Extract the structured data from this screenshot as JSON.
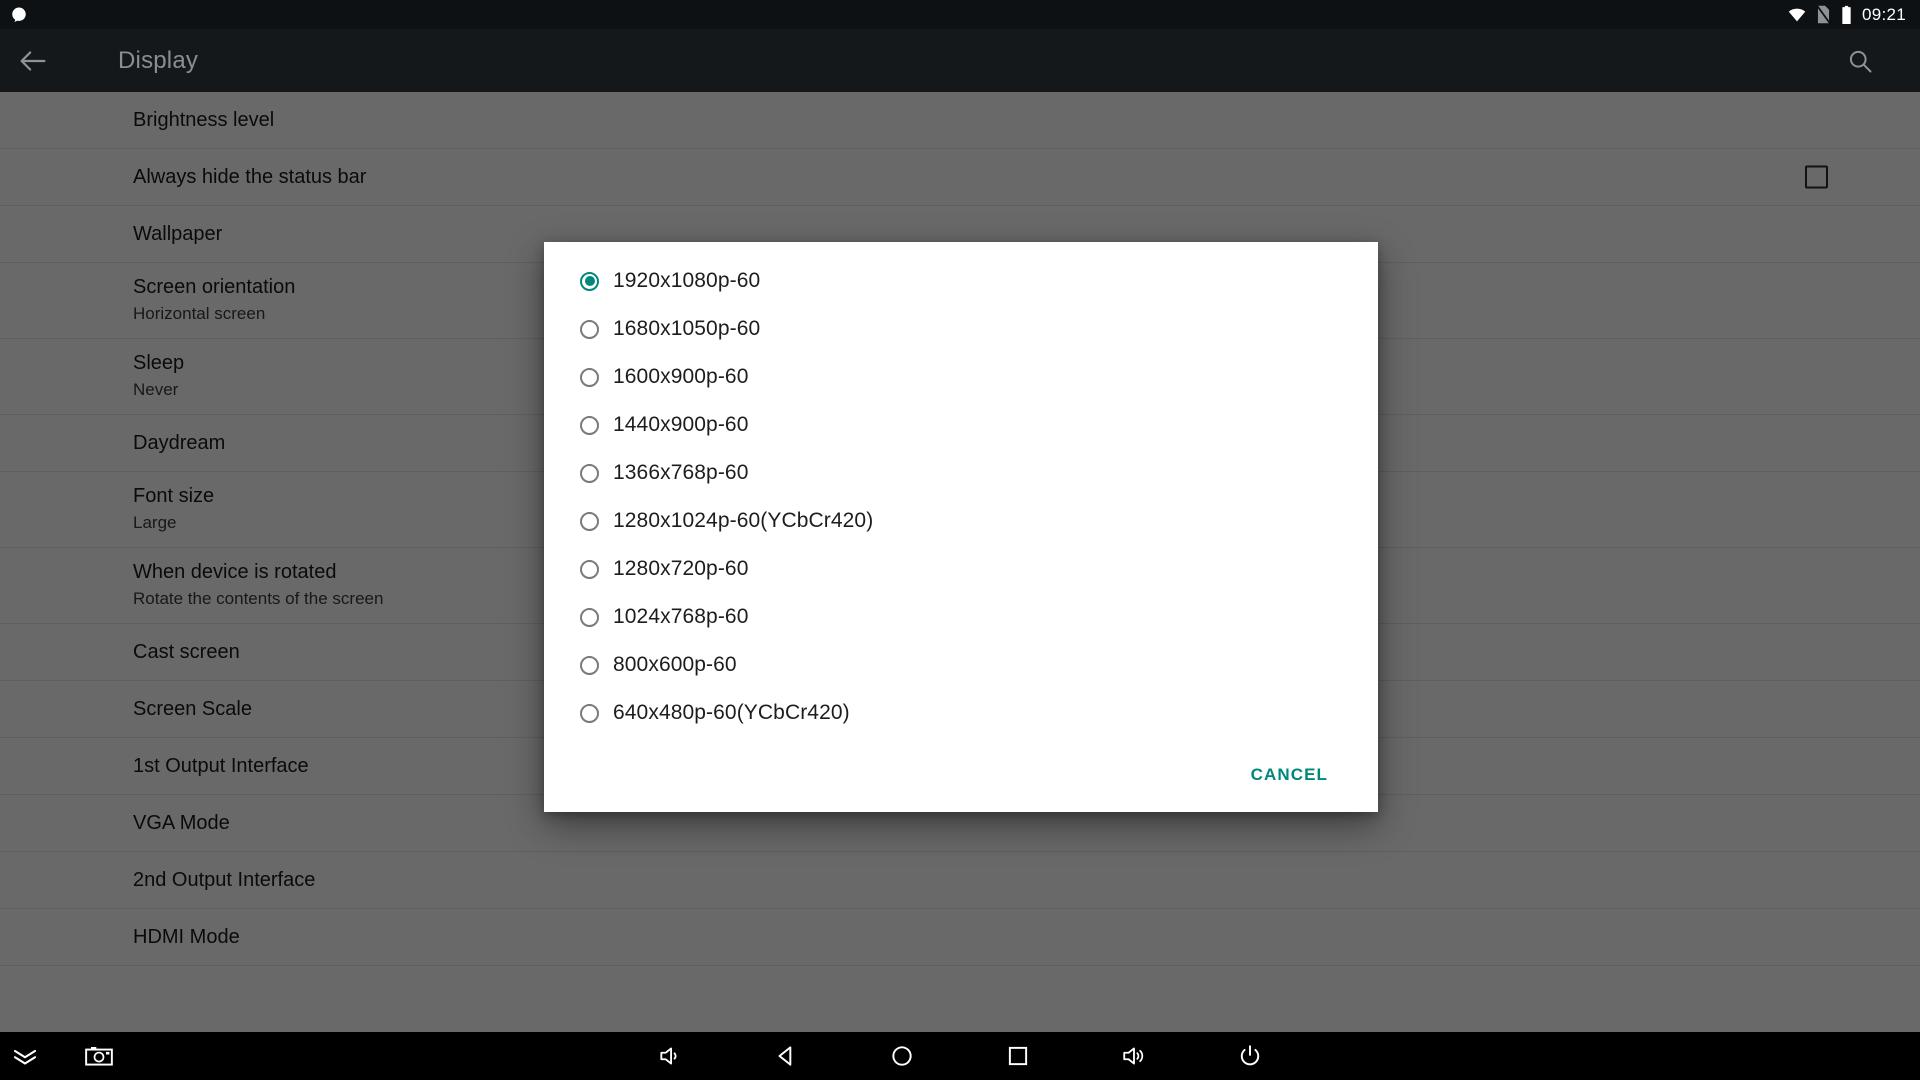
{
  "status_bar": {
    "notification_icon": "blob-icon",
    "wifi_icon": "wifi-icon",
    "sim_off_icon": "sim-card-off-icon",
    "battery_icon": "battery-full-icon",
    "time": "09:21"
  },
  "action_bar": {
    "back_icon": "back-arrow-icon",
    "title": "Display",
    "search_icon": "search-icon"
  },
  "settings": {
    "rows": [
      {
        "title": "Brightness level",
        "subtitle": "",
        "checkbox": false
      },
      {
        "title": "Always hide the status bar",
        "subtitle": "",
        "checkbox": true,
        "checked": false
      },
      {
        "title": "Wallpaper",
        "subtitle": "",
        "checkbox": false
      },
      {
        "title": "Screen orientation",
        "subtitle": "Horizontal screen",
        "checkbox": false
      },
      {
        "title": "Sleep",
        "subtitle": "Never",
        "checkbox": false
      },
      {
        "title": "Daydream",
        "subtitle": "",
        "checkbox": false
      },
      {
        "title": "Font size",
        "subtitle": "Large",
        "checkbox": false
      },
      {
        "title": "When device is rotated",
        "subtitle": "Rotate the contents of the screen",
        "checkbox": false
      },
      {
        "title": "Cast screen",
        "subtitle": "",
        "checkbox": false
      },
      {
        "title": "Screen Scale",
        "subtitle": "",
        "checkbox": false
      },
      {
        "title": "1st Output Interface",
        "subtitle": "",
        "checkbox": false
      },
      {
        "title": "VGA Mode",
        "subtitle": "",
        "checkbox": false
      },
      {
        "title": "2nd Output Interface",
        "subtitle": "",
        "checkbox": false
      },
      {
        "title": "HDMI Mode",
        "subtitle": "",
        "checkbox": false
      }
    ]
  },
  "dialog": {
    "selected_index": 0,
    "options": [
      "1920x1080p-60",
      "1680x1050p-60",
      "1600x900p-60",
      "1440x900p-60",
      "1366x768p-60",
      "1280x1024p-60(YCbCr420)",
      "1280x720p-60",
      "1024x768p-60",
      "800x600p-60",
      "640x480p-60(YCbCr420)"
    ],
    "cancel_label": "CANCEL",
    "accent_color": "#00897b"
  },
  "nav_bar": {
    "items": [
      {
        "name": "notification-pulldown-icon"
      },
      {
        "name": "screenshot-camera-icon"
      },
      {
        "name": "volume-down-icon"
      },
      {
        "name": "back-icon"
      },
      {
        "name": "home-icon"
      },
      {
        "name": "recents-icon"
      },
      {
        "name": "volume-up-icon"
      },
      {
        "name": "power-icon"
      }
    ]
  }
}
